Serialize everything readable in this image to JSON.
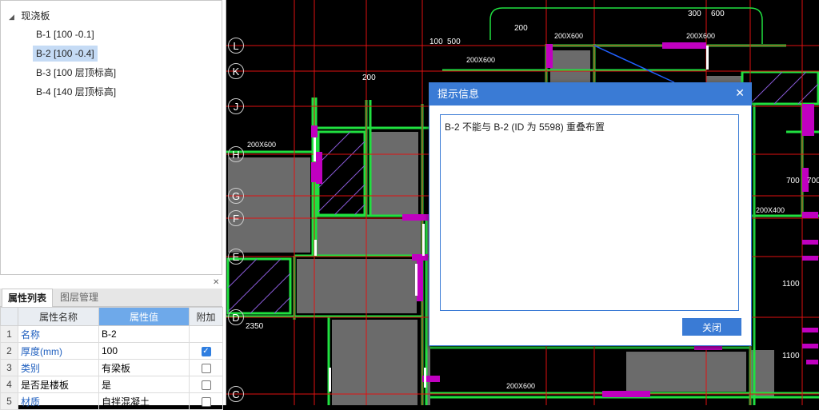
{
  "tree": {
    "root": "现浇板",
    "items": [
      "B-1 [100 -0.1]",
      "B-2 [100 -0.4]",
      "B-3 [100 层顶标高]",
      "B-4 [140 层顶标高]"
    ],
    "selected_index": 1
  },
  "panel": {
    "tabs": [
      "属性列表",
      "图层管理"
    ],
    "headers": [
      "属性名称",
      "属性值",
      "附加"
    ],
    "rows": [
      {
        "n": "1",
        "name": "名称",
        "value": "B-2",
        "checked": null
      },
      {
        "n": "2",
        "name": "厚度(mm)",
        "value": "100",
        "checked": true
      },
      {
        "n": "3",
        "name": "类别",
        "value": "有梁板",
        "checked": false
      },
      {
        "n": "4",
        "name": "是否是楼板",
        "value": "是",
        "checked": false
      },
      {
        "n": "5",
        "name": "材质",
        "value": "自拌混凝土",
        "checked": false
      }
    ]
  },
  "axes": [
    "L",
    "K",
    "J",
    "H",
    "G",
    "F",
    "E",
    "D",
    "C"
  ],
  "cad_labels": [
    "200X600",
    "200X600",
    "200X600",
    "200X600",
    "200X600",
    "200X400",
    "300",
    "600",
    "100",
    "500",
    "200",
    "200",
    "2350",
    "700",
    "700",
    "1100",
    "1100"
  ],
  "dialog": {
    "title": "提示信息",
    "message": "B-2 不能与 B-2 (ID 为 5598) 重叠布置",
    "close_button": "关闭"
  },
  "colors": {
    "accent": "#3a7bd5",
    "wall": "#20e040",
    "slab": "#6b6b6b",
    "grid": "#e01010",
    "beam": "#c000c0"
  }
}
